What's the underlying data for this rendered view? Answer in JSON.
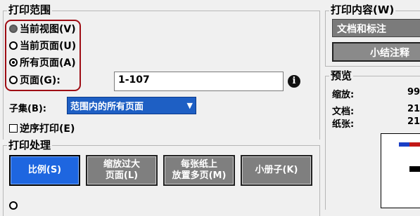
{
  "print_range": {
    "title": "打印范围",
    "options": [
      {
        "label": "当前视图(V)"
      },
      {
        "label": "当前页面(U)"
      },
      {
        "label": "所有页面(A)"
      },
      {
        "label": "页面(G):"
      }
    ],
    "selected_index": 2,
    "pages_value": "1-107",
    "info_icon": "info-icon",
    "subset_label": "子集(B):",
    "subset_value": "范围内的所有页面",
    "reverse_label": "逆序打印(E)"
  },
  "print_handling": {
    "title": "打印处理",
    "buttons": [
      {
        "label": "比例(S)"
      },
      {
        "label": "缩放过大\n页面(L)"
      },
      {
        "label": "每张纸上\n放置多页(M)"
      },
      {
        "label": "小册子(K)"
      }
    ]
  },
  "print_content": {
    "title": "打印内容(W)",
    "value": "文档和标注",
    "summarize_label": "小结注释"
  },
  "preview": {
    "title": "预览",
    "zoom_label": "缩放:",
    "zoom_value": "99",
    "doc_label": "文档:",
    "doc_value": "21.",
    "paper_label": "纸张:",
    "paper_value": "21."
  },
  "colors": {
    "accent": "#1e66e0",
    "highlight_border": "#9e0d14"
  }
}
